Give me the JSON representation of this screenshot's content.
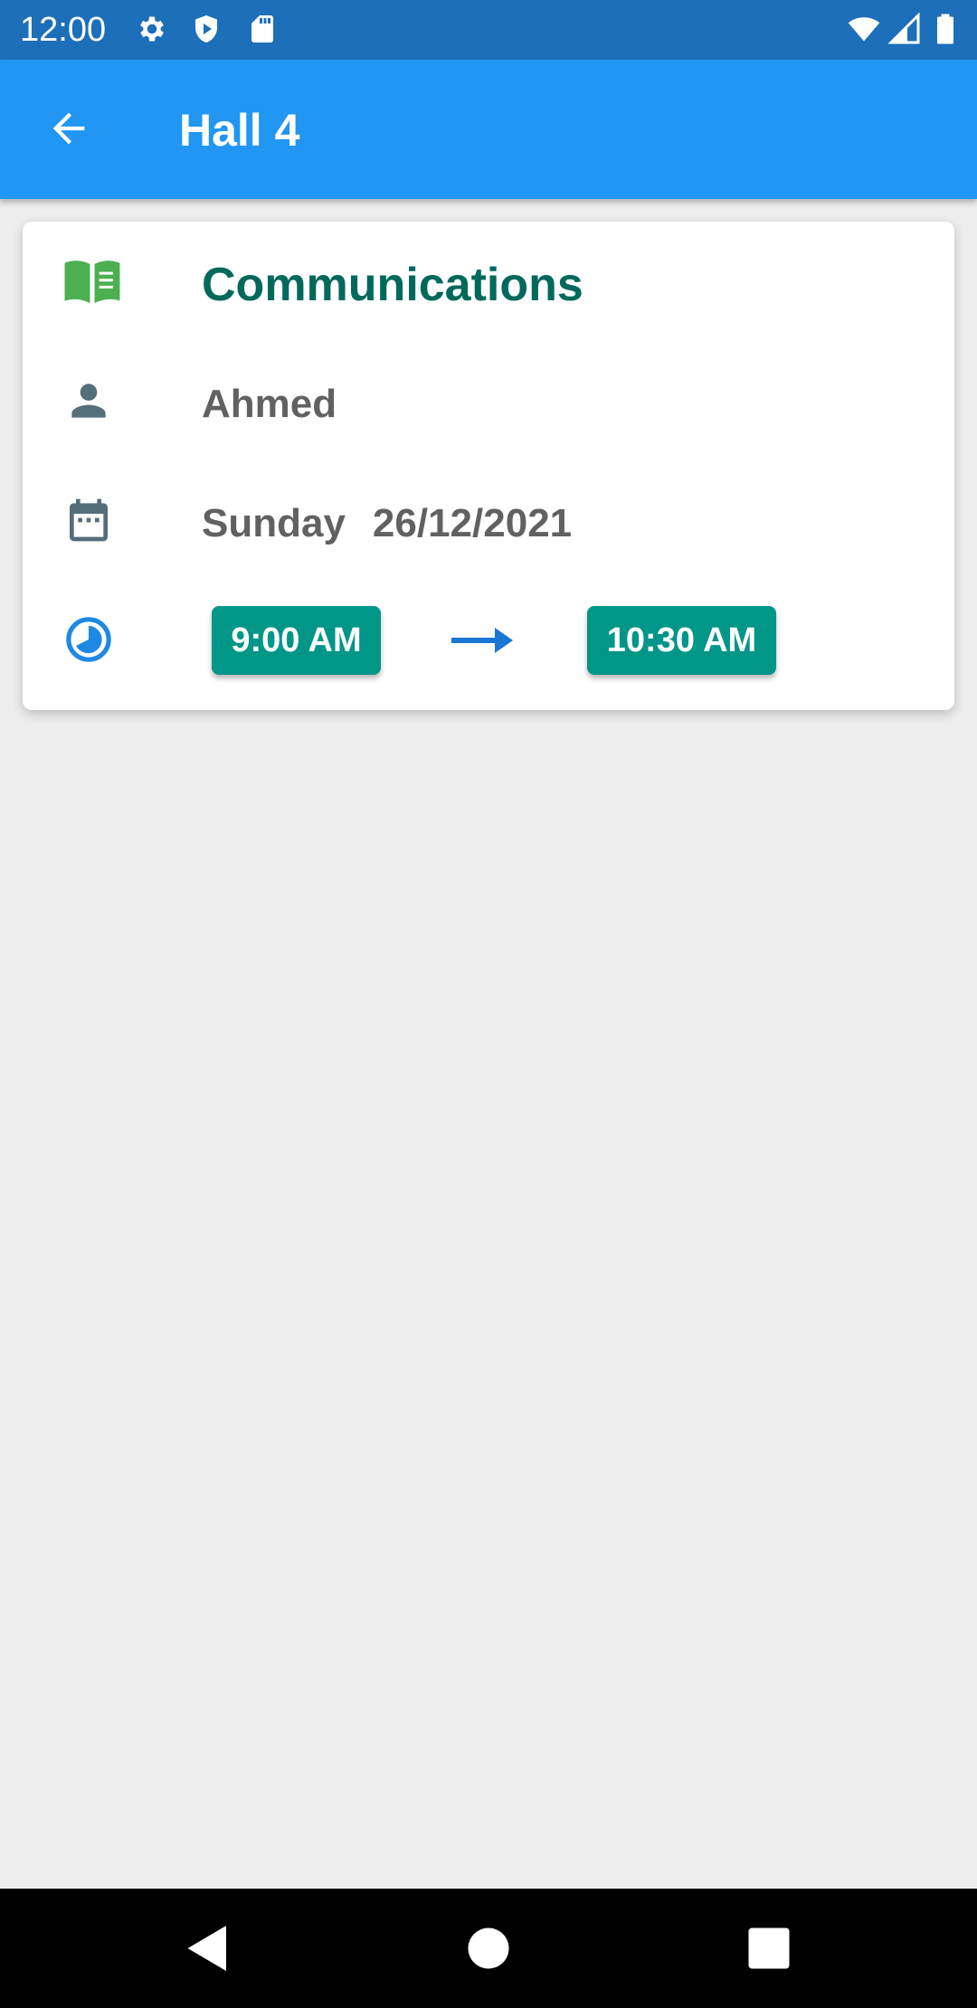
{
  "status_bar": {
    "time": "12:00",
    "left_icons": [
      "settings-icon",
      "shield-icon",
      "sd-card-icon"
    ],
    "right_icons": [
      "wifi-icon",
      "signal-icon",
      "battery-icon"
    ]
  },
  "app_bar": {
    "title": "Hall 4",
    "back_icon": "arrow-back-icon",
    "color": "#2196f3"
  },
  "lecture": {
    "course": "Communications",
    "course_icon": "book-open-icon",
    "instructor": "Ahmed",
    "instructor_icon": "person-icon",
    "day": "Sunday",
    "date": "26/12/2021",
    "date_icon": "calendar-icon",
    "time_icon": "clock-icon",
    "start_time": "9:00 AM",
    "end_time": "10:30 AM",
    "arrow_icon": "arrow-right-icon"
  },
  "colors": {
    "status_bar": "#1c6fb8",
    "course_title": "#00695c",
    "chip": "#009688",
    "book_icon": "#4caf50",
    "person_icon": "#546e7a",
    "clock_icon": "#1e88e5",
    "background": "#eeeeee"
  },
  "nav_bar": {
    "buttons": [
      "back-triangle-icon",
      "home-circle-icon",
      "recents-square-icon"
    ]
  }
}
